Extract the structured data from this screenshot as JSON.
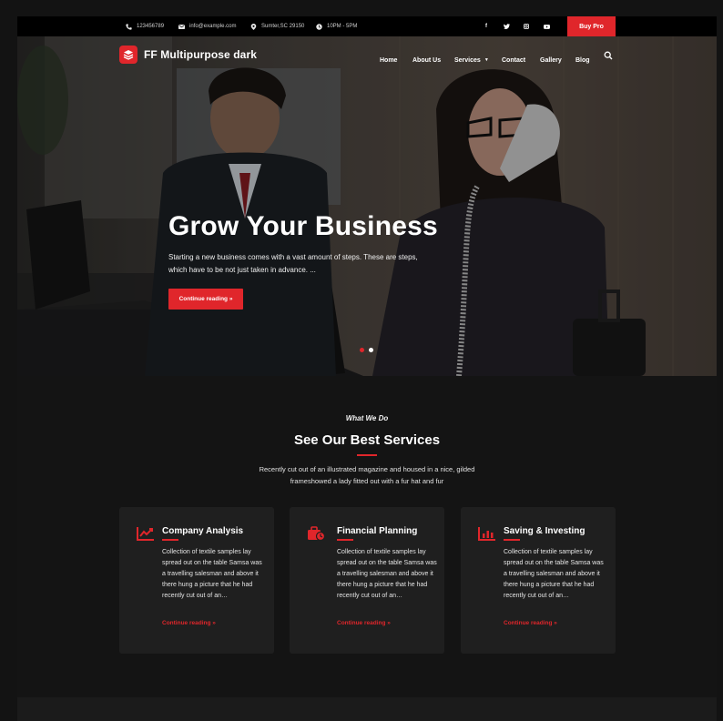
{
  "topbar": {
    "phone": "123456789",
    "email": "info@example.com",
    "location": "Sumter,SC 29150",
    "hours": "10PM - 5PM",
    "social": [
      "f",
      "t",
      "ig",
      "yt"
    ],
    "buy_label": "Buy Pro"
  },
  "brand": {
    "name": "FF Multipurpose dark",
    "accent": "#e0262b"
  },
  "nav": {
    "items": [
      "Home",
      "About Us",
      "Services",
      "Contact",
      "Gallery",
      "Blog"
    ]
  },
  "hero": {
    "title": "Grow Your Business",
    "text": "Starting a new business comes with a vast amount of steps. These are steps, which have to be not just taken in advance. ...",
    "button": "Continue reading »",
    "slides": 2,
    "active_slide": 1
  },
  "services": {
    "eyebrow": "What We Do",
    "title": "See Our Best Services",
    "description": "Recently cut out of an illustrated magazine and housed in a nice, gilded frameshowed a lady fitted out with a fur hat and fur",
    "cards": [
      {
        "icon": "chart-line-icon",
        "title": "Company Analysis",
        "text": "Collection of textile samples lay spread out on the table Samsa was a travelling salesman and above it there hung a picture that he had recently cut out of an…",
        "link": "Continue reading »"
      },
      {
        "icon": "briefcase-clock-icon",
        "title": "Financial Planning",
        "text": "Collection of textile samples lay spread out on the table Samsa was a travelling salesman and above it there hung a picture that he had recently cut out of an…",
        "link": "Continue reading »"
      },
      {
        "icon": "bar-chart-icon",
        "title": "Saving & Investing",
        "text": "Collection of textile samples lay spread out on the table Samsa was a travelling salesman and above it there hung a picture that he had recently cut out of an…",
        "link": "Continue reading »"
      }
    ]
  }
}
